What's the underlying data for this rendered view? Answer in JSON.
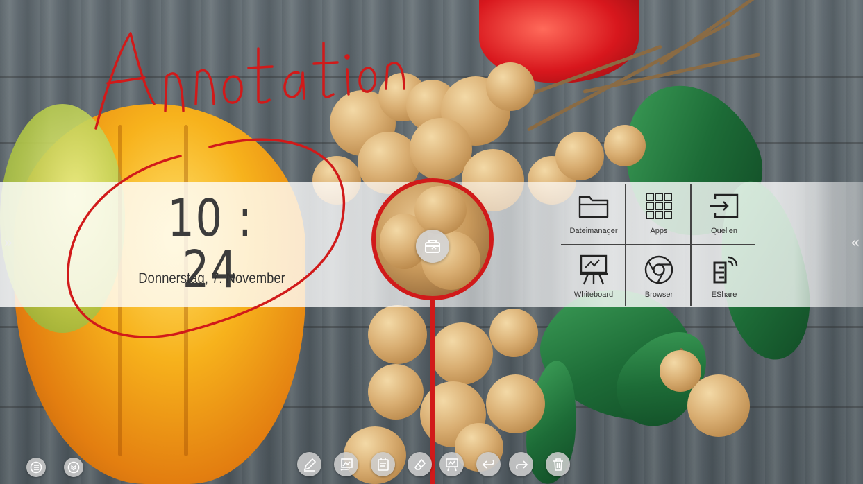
{
  "clock": {
    "time": "10 : 24",
    "date": "Donnerstag, 7. November"
  },
  "annotation": {
    "text": "Annotation",
    "color": "#d11a1a"
  },
  "apps": [
    {
      "label": "Dateimanager",
      "icon": "folder-icon"
    },
    {
      "label": "Apps",
      "icon": "apps-grid-icon"
    },
    {
      "label": "Quellen",
      "icon": "input-source-icon"
    },
    {
      "label": "Whiteboard",
      "icon": "whiteboard-icon"
    },
    {
      "label": "Browser",
      "icon": "chrome-browser-icon"
    },
    {
      "label": "EShare",
      "icon": "eshare-icon"
    }
  ],
  "side_arrows": {
    "left": "»",
    "right": "«"
  },
  "toolbar": [
    "pen-icon",
    "screenshot-icon",
    "notes-icon",
    "eraser-icon",
    "whiteboard-icon",
    "undo-icon",
    "redo-icon",
    "trash-icon"
  ],
  "left_toolbar": [
    "menu-list-icon",
    "collapse-down-icon"
  ],
  "center_tool": "toolbox-icon"
}
